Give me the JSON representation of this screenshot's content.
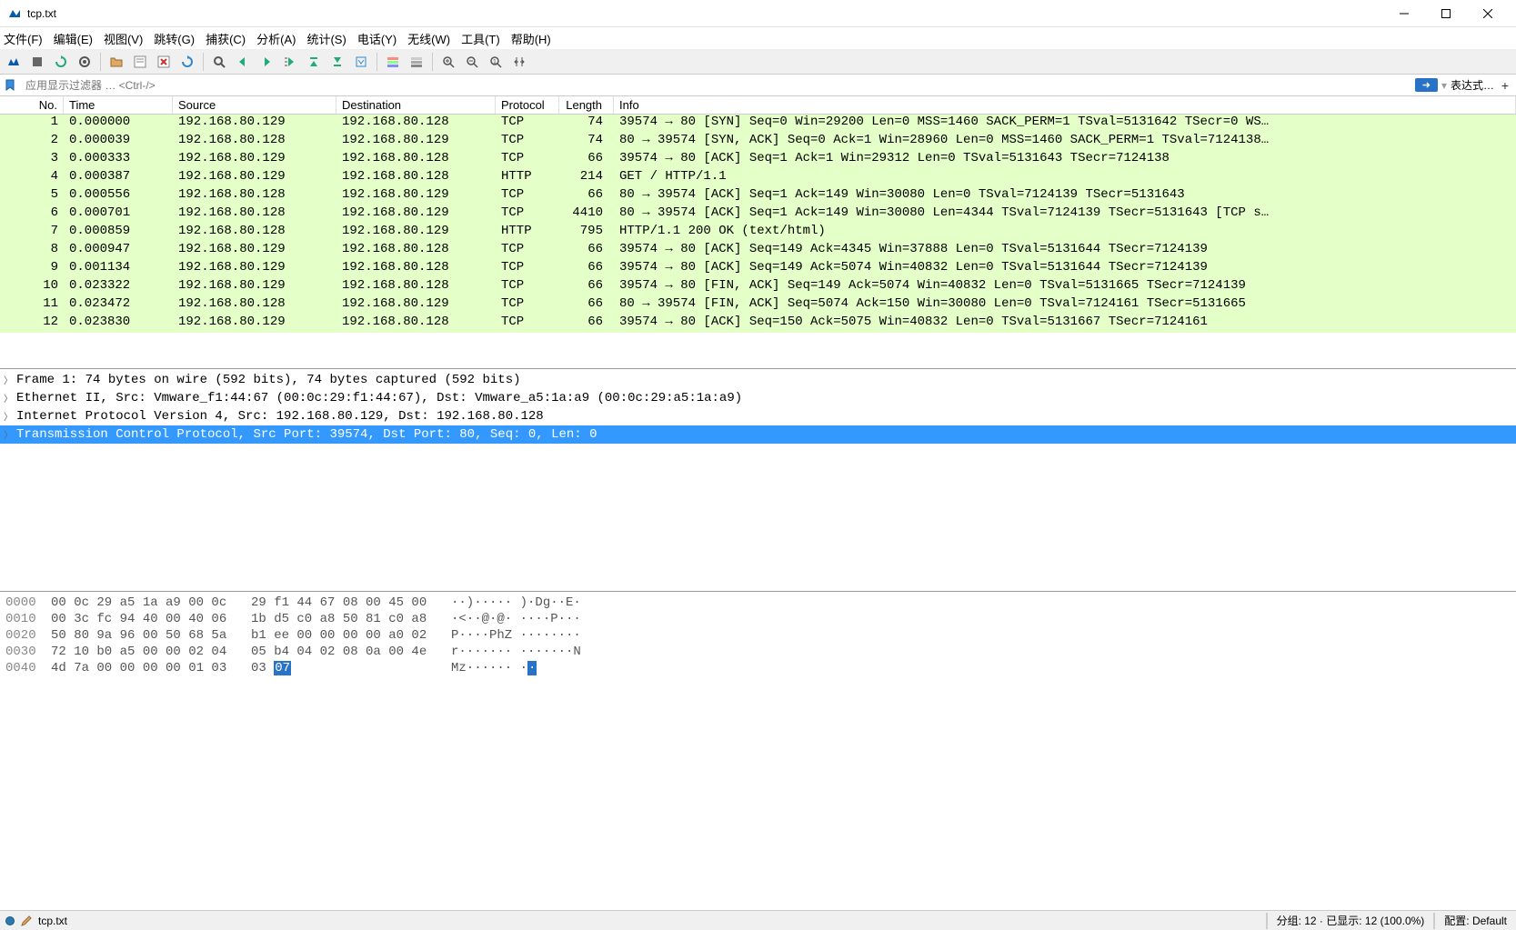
{
  "window": {
    "title": "tcp.txt"
  },
  "menu": {
    "file": "文件(F)",
    "edit": "编辑(E)",
    "view": "视图(V)",
    "go": "跳转(G)",
    "capture": "捕获(C)",
    "analyze": "分析(A)",
    "statistics": "统计(S)",
    "telephony": "电话(Y)",
    "wireless": "无线(W)",
    "tools": "工具(T)",
    "help": "帮助(H)"
  },
  "filter": {
    "placeholder": "应用显示过滤器 … <Ctrl-/>",
    "expression_label": "表达式…",
    "apply_arrow": "➜"
  },
  "columns": {
    "no": "No.",
    "time": "Time",
    "source": "Source",
    "destination": "Destination",
    "protocol": "Protocol",
    "length": "Length",
    "info": "Info"
  },
  "packets": [
    {
      "no": "1",
      "time": "0.000000",
      "src": "192.168.80.129",
      "dst": "192.168.80.128",
      "proto": "TCP",
      "len": "74",
      "info": "39574 → 80 [SYN] Seq=0 Win=29200 Len=0 MSS=1460 SACK_PERM=1 TSval=5131642 TSecr=0 WS…",
      "cls": "tcp"
    },
    {
      "no": "2",
      "time": "0.000039",
      "src": "192.168.80.128",
      "dst": "192.168.80.129",
      "proto": "TCP",
      "len": "74",
      "info": "80 → 39574 [SYN, ACK] Seq=0 Ack=1 Win=28960 Len=0 MSS=1460 SACK_PERM=1 TSval=7124138…",
      "cls": "tcp"
    },
    {
      "no": "3",
      "time": "0.000333",
      "src": "192.168.80.129",
      "dst": "192.168.80.128",
      "proto": "TCP",
      "len": "66",
      "info": "39574 → 80 [ACK] Seq=1 Ack=1 Win=29312 Len=0 TSval=5131643 TSecr=7124138",
      "cls": "tcp"
    },
    {
      "no": "4",
      "time": "0.000387",
      "src": "192.168.80.129",
      "dst": "192.168.80.128",
      "proto": "HTTP",
      "len": "214",
      "info": "GET / HTTP/1.1",
      "cls": "http"
    },
    {
      "no": "5",
      "time": "0.000556",
      "src": "192.168.80.128",
      "dst": "192.168.80.129",
      "proto": "TCP",
      "len": "66",
      "info": "80 → 39574 [ACK] Seq=1 Ack=149 Win=30080 Len=0 TSval=7124139 TSecr=5131643",
      "cls": "tcp"
    },
    {
      "no": "6",
      "time": "0.000701",
      "src": "192.168.80.128",
      "dst": "192.168.80.129",
      "proto": "TCP",
      "len": "4410",
      "info": "80 → 39574 [ACK] Seq=1 Ack=149 Win=30080 Len=4344 TSval=7124139 TSecr=5131643 [TCP s…",
      "cls": "tcp"
    },
    {
      "no": "7",
      "time": "0.000859",
      "src": "192.168.80.128",
      "dst": "192.168.80.129",
      "proto": "HTTP",
      "len": "795",
      "info": "HTTP/1.1 200 OK  (text/html)",
      "cls": "http"
    },
    {
      "no": "8",
      "time": "0.000947",
      "src": "192.168.80.129",
      "dst": "192.168.80.128",
      "proto": "TCP",
      "len": "66",
      "info": "39574 → 80 [ACK] Seq=149 Ack=4345 Win=37888 Len=0 TSval=5131644 TSecr=7124139",
      "cls": "tcp"
    },
    {
      "no": "9",
      "time": "0.001134",
      "src": "192.168.80.129",
      "dst": "192.168.80.128",
      "proto": "TCP",
      "len": "66",
      "info": "39574 → 80 [ACK] Seq=149 Ack=5074 Win=40832 Len=0 TSval=5131644 TSecr=7124139",
      "cls": "tcp"
    },
    {
      "no": "10",
      "time": "0.023322",
      "src": "192.168.80.129",
      "dst": "192.168.80.128",
      "proto": "TCP",
      "len": "66",
      "info": "39574 → 80 [FIN, ACK] Seq=149 Ack=5074 Win=40832 Len=0 TSval=5131665 TSecr=7124139",
      "cls": "tcp"
    },
    {
      "no": "11",
      "time": "0.023472",
      "src": "192.168.80.128",
      "dst": "192.168.80.129",
      "proto": "TCP",
      "len": "66",
      "info": "80 → 39574 [FIN, ACK] Seq=5074 Ack=150 Win=30080 Len=0 TSval=7124161 TSecr=5131665",
      "cls": "tcp"
    },
    {
      "no": "12",
      "time": "0.023830",
      "src": "192.168.80.129",
      "dst": "192.168.80.128",
      "proto": "TCP",
      "len": "66",
      "info": "39574 → 80 [ACK] Seq=150 Ack=5075 Win=40832 Len=0 TSval=5131667 TSecr=7124161",
      "cls": "tcp"
    }
  ],
  "tree": [
    {
      "text": "Frame 1: 74 bytes on wire (592 bits), 74 bytes captured (592 bits)",
      "selected": false
    },
    {
      "text": "Ethernet II, Src: Vmware_f1:44:67 (00:0c:29:f1:44:67), Dst: Vmware_a5:1a:a9 (00:0c:29:a5:1a:a9)",
      "selected": false
    },
    {
      "text": "Internet Protocol Version 4, Src: 192.168.80.129, Dst: 192.168.80.128",
      "selected": false
    },
    {
      "text": "Transmission Control Protocol, Src Port: 39574, Dst Port: 80, Seq: 0, Len: 0",
      "selected": true
    }
  ],
  "hex": [
    {
      "offset": "0000",
      "b1": "00 0c 29 a5 1a a9 00 0c",
      "b2": "29 f1 44 67 08 00 45 00",
      "ascii": "··)·····  )·Dg··E·"
    },
    {
      "offset": "0010",
      "b1": "00 3c fc 94 40 00 40 06",
      "b2": "1b d5 c0 a8 50 81 c0 a8",
      "ascii": "·<··@·@·  ····P···"
    },
    {
      "offset": "0020",
      "b1": "50 80 9a 96 00 50 68 5a",
      "b2": "b1 ee 00 00 00 00 a0 02",
      "ascii": "P····PhZ  ········"
    },
    {
      "offset": "0030",
      "b1": "72 10 b0 a5 00 00 02 04",
      "b2": "05 b4 04 02 08 0a 00 4e",
      "ascii": "r·······  ·······N"
    },
    {
      "offset": "0040",
      "b1": "4d 7a 00 00 00 00 01 03",
      "b2": "03 ",
      "b2sel": "07",
      "ascii": "Mz······  ·",
      "asciisel": "·"
    }
  ],
  "status": {
    "file": "tcp.txt",
    "packets_label": "分组: 12  · 已显示: 12 (100.0%)",
    "profile_label": "配置: Default"
  }
}
